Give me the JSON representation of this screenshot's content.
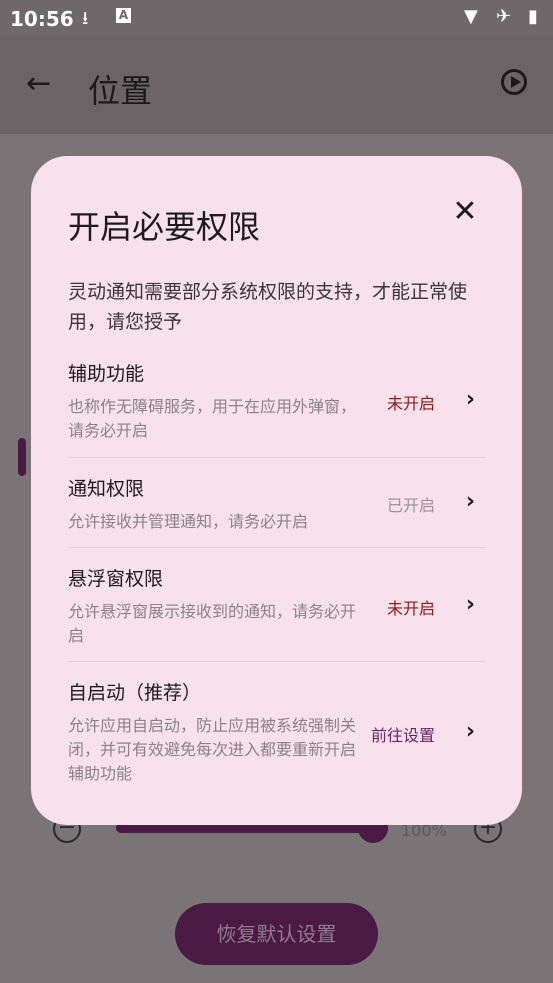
{
  "status_bar": {
    "time": "10:56"
  },
  "app_bar": {
    "title": "位置"
  },
  "background": {
    "percent": "100%",
    "reset_button": "恢复默认设置"
  },
  "dialog": {
    "title": "开启必要权限",
    "description": "灵动通知需要部分系统权限的支持，才能正常使用，请您授予",
    "permissions": [
      {
        "name": "辅助功能",
        "description": "也称作无障碍服务，用于在应用外弹窗，请务必开启",
        "status": "未开启",
        "status_color": "#8b1a1a"
      },
      {
        "name": "通知权限",
        "description": "允许接收并管理通知，请务必开启",
        "status": "已开启",
        "status_color": "#9a9296"
      },
      {
        "name": "悬浮窗权限",
        "description": "允许悬浮窗展示接收到的通知，请务必开启",
        "status": "未开启",
        "status_color": "#8b1a1a"
      },
      {
        "name": "自启动（推荐）",
        "description": "允许应用自启动，防止应用被系统强制关闭，并可有效避免每次进入都要重新开启辅助功能",
        "status": "前往设置",
        "status_color": "#6b2466"
      }
    ]
  }
}
